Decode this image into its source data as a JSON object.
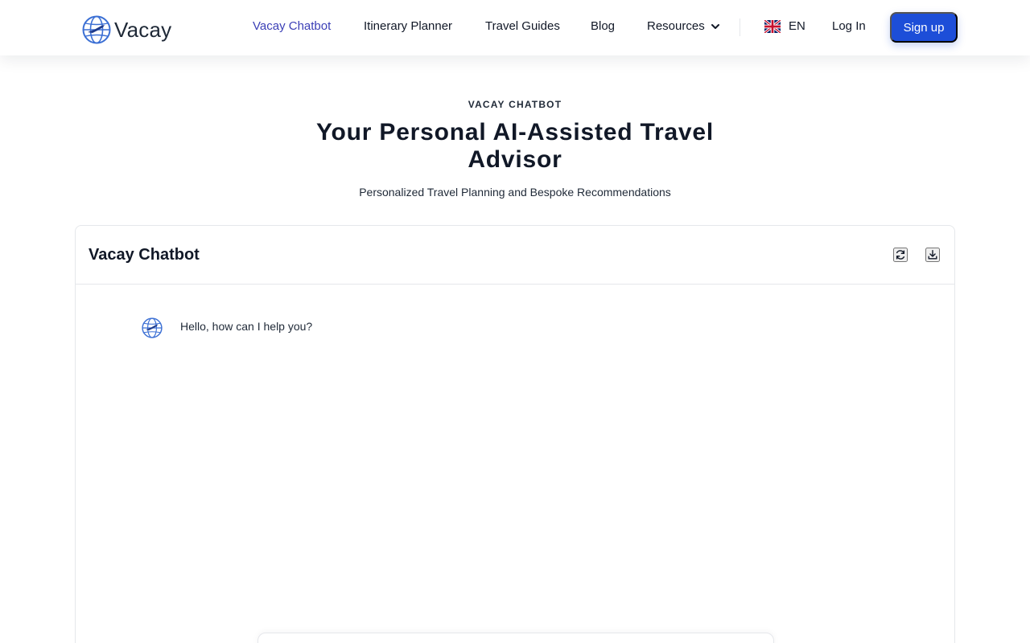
{
  "brand": {
    "name": "Vacay",
    "accent": "#3b3fb6",
    "primary": "#1d4ed8"
  },
  "nav": {
    "links": [
      "Vacay Chatbot",
      "Itinerary Planner",
      "Travel Guides",
      "Blog"
    ],
    "resources": "Resources",
    "language": {
      "flag": "uk-flag-icon",
      "code": "EN"
    },
    "login": "Log In",
    "signup": "Sign up"
  },
  "hero": {
    "eyebrow": "VACAY CHATBOT",
    "title": "Your Personal AI-Assisted Travel Advisor",
    "subtitle": "Personalized Travel Planning and Bespoke Recommendations"
  },
  "chat": {
    "title": "Vacay Chatbot",
    "actions": [
      "refresh-icon",
      "download-icon"
    ],
    "messages": [
      {
        "sender": "bot",
        "avatar": "globe-plane-icon",
        "text": "Hello, how can I help you?"
      }
    ]
  }
}
